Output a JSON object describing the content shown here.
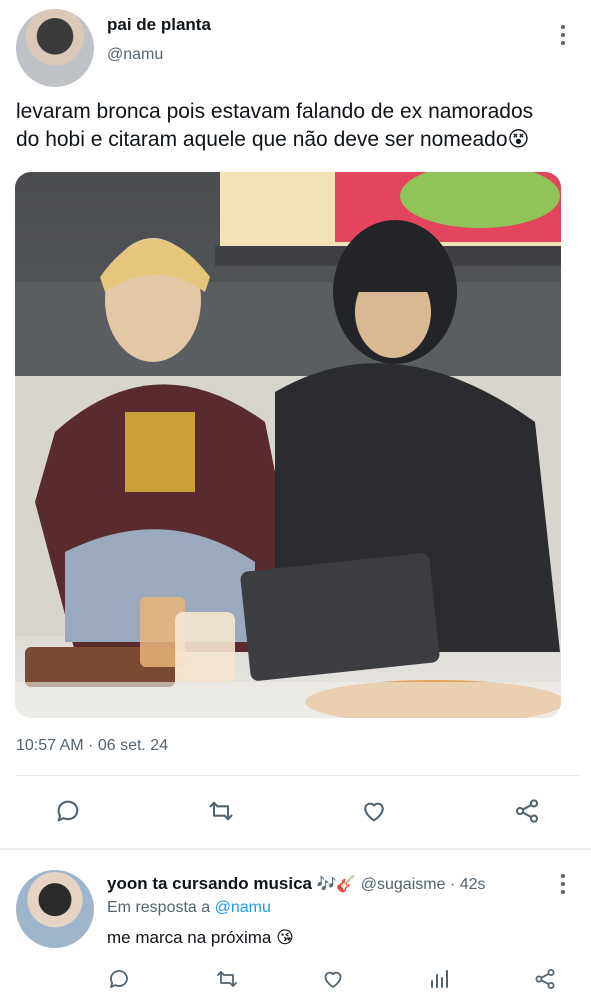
{
  "tweet": {
    "author_name": "pai de planta",
    "author_handle": "@namu",
    "text_line1": "levaram bronca pois estavam falando de ex namorados",
    "text_line2": "do hobi e citaram aquele que não deve ser nomeado",
    "text_emoji": "😵",
    "timestamp": "10:57 AM · 06 set. 24"
  },
  "reply": {
    "author_name": "yoon ta cursando musica",
    "author_emoji": "🎶🎸",
    "author_handle": "@sugaisme",
    "time_ago": "· 42s",
    "in_reply_prefix": "Em resposta a",
    "in_reply_handle": "@namu",
    "text": "me marca na próxima",
    "text_emoji": "😘"
  },
  "colors": {
    "text": "#0f1419",
    "secondary": "#536471",
    "link": "#1d9bf0",
    "divider": "#e6ecf0"
  },
  "icons": {
    "reply": "reply-icon",
    "retweet": "retweet-icon",
    "like": "like-icon",
    "share": "share-icon",
    "views": "views-icon",
    "more": "more-icon"
  }
}
